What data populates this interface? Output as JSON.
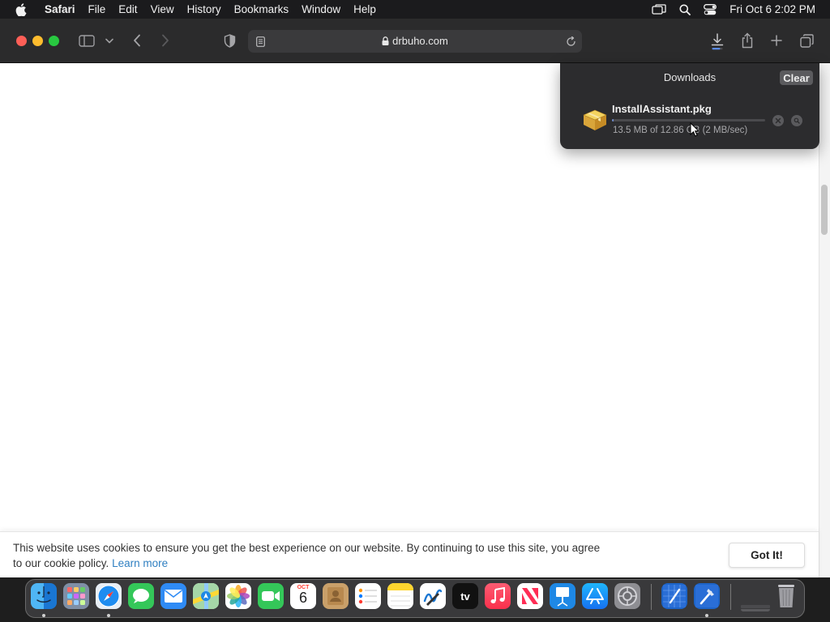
{
  "menubar": {
    "items": [
      "Safari",
      "File",
      "Edit",
      "View",
      "History",
      "Bookmarks",
      "Window",
      "Help"
    ],
    "clock": "Fri Oct 6  2:02 PM"
  },
  "toolbar": {
    "url": "drbuho.com"
  },
  "downloads": {
    "title": "Downloads",
    "clear_label": "Clear",
    "item": {
      "filename": "InstallAssistant.pkg",
      "status": "13.5 MB of 12.86 GB (2 MB/sec)",
      "progress_fraction": 0.01
    }
  },
  "cookie_banner": {
    "message_line1": "This website uses cookies to ensure you get the best experience on our website. By continuing to use this site, you agree",
    "message_line2": "to our cookie policy.",
    "learn_more": "Learn more",
    "button_label": "Got It!"
  },
  "dock": {
    "calendar_month": "OCT",
    "calendar_day": "6",
    "tv_label": "tv",
    "apps": [
      "Finder",
      "Launchpad",
      "Safari",
      "Messages",
      "Mail",
      "Maps",
      "Photos",
      "FaceTime",
      "Calendar",
      "Contacts",
      "Reminders",
      "Notes",
      "Freeform",
      "TV",
      "Music",
      "News",
      "Keynote",
      "App Store",
      "System Settings",
      "Xcode",
      "Xcode Installer",
      "Downloads",
      "Trash"
    ]
  },
  "colors": {
    "accent_blue": "#2f7fc1",
    "progress_fill": "#6d89c9",
    "close_red": "#fe5f57",
    "minimize_yellow": "#febc2e",
    "zoom_green": "#28c840"
  }
}
